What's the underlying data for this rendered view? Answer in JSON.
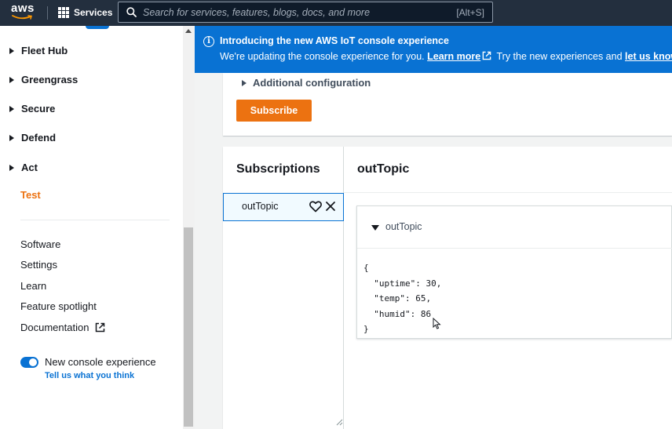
{
  "topnav": {
    "logo_text": "aws",
    "services_label": "Services",
    "search_placeholder": "Search for services, features, blogs, docs, and more",
    "search_shortcut": "[Alt+S]"
  },
  "sidebar": {
    "sections": [
      {
        "label": "Fleet Hub"
      },
      {
        "label": "Greengrass"
      },
      {
        "label": "Secure"
      },
      {
        "label": "Defend"
      },
      {
        "label": "Act"
      }
    ],
    "active_item": "Test",
    "links": [
      {
        "label": "Software"
      },
      {
        "label": "Settings"
      },
      {
        "label": "Learn"
      },
      {
        "label": "Feature spotlight"
      },
      {
        "label": "Documentation"
      }
    ],
    "toggle_label": "New console experience",
    "feedback_link": "Tell us what you think"
  },
  "banner": {
    "title": "Introducing the new AWS IoT console experience",
    "text_before": "We're updating the console experience for you.",
    "learn_more": "Learn more",
    "text_middle": "Try the new experiences and",
    "let_us_know": "let us know"
  },
  "top_panel": {
    "additional_config": "Additional configuration",
    "subscribe_label": "Subscribe"
  },
  "subscriptions": {
    "heading": "Subscriptions",
    "items": [
      {
        "name": "outTopic"
      }
    ],
    "selected_title": "outTopic"
  },
  "message": {
    "topic": "outTopic",
    "lines": [
      "{",
      "  \"uptime\": 30,",
      "  \"temp\": 65,",
      "  \"humid\": 86",
      "}"
    ]
  },
  "colors": {
    "nav_bg": "#232f3e",
    "banner_bg": "#0972d3",
    "accent_orange": "#ec7211",
    "link_blue": "#0972d3"
  }
}
